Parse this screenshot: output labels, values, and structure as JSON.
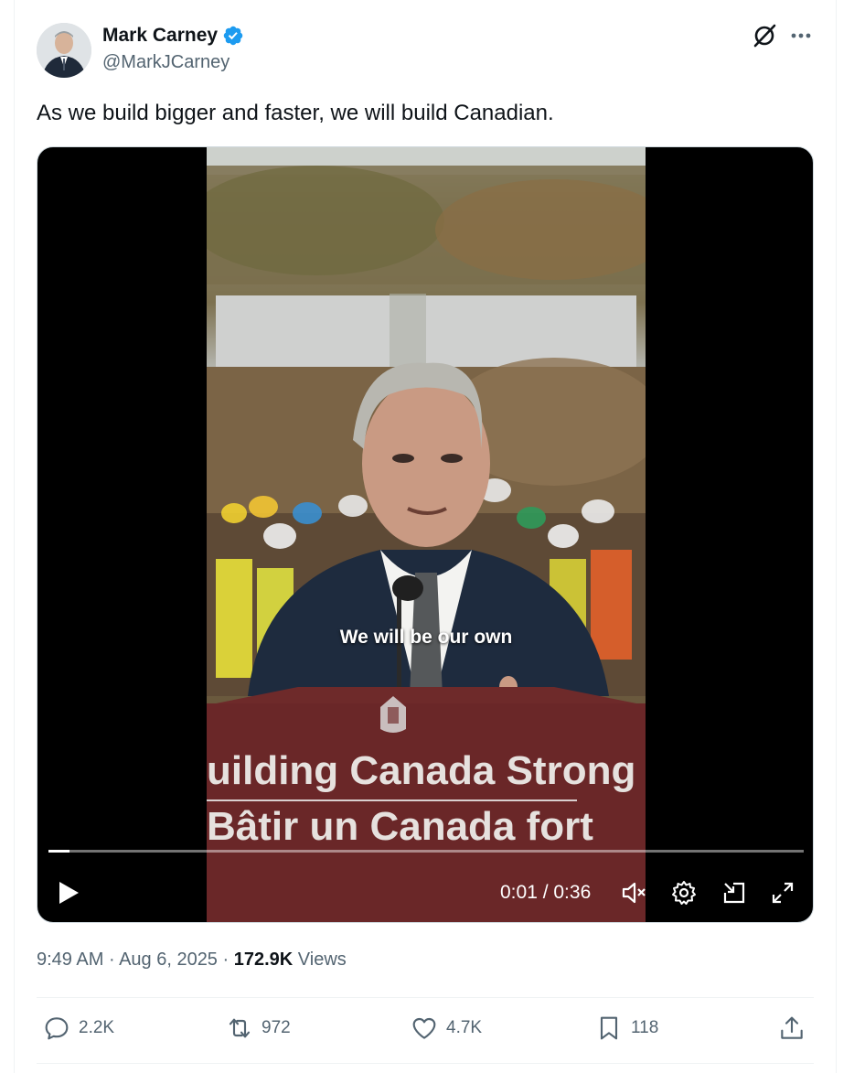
{
  "author": {
    "name": "Mark Carney",
    "handle": "@MarkJCarney",
    "verified": true
  },
  "tweet": {
    "text": "As we build bigger and faster, we will build Canadian."
  },
  "video": {
    "caption": "We will be our own",
    "podium_line1": "uilding Canada Strong",
    "podium_line2": "Bâtir un Canada fort",
    "current_time": "0:01",
    "duration": "0:36",
    "time_display": "0:01 / 0:36",
    "progress": 0.028,
    "muted": true
  },
  "meta": {
    "time": "9:49 AM",
    "date": "Aug 6, 2025",
    "views_count": "172.9K",
    "views_label": "Views",
    "sep1": " · ",
    "sep2": " · "
  },
  "actions": {
    "replies": "2.2K",
    "reposts": "972",
    "likes": "4.7K",
    "bookmarks": "118"
  },
  "colors": {
    "verified": "#1d9bf0",
    "muted_text": "#536471"
  }
}
